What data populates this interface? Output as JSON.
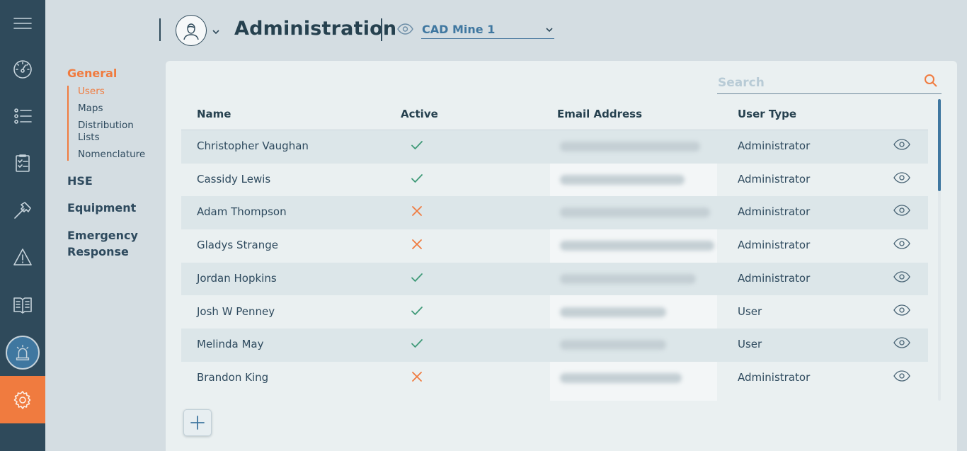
{
  "header": {
    "title": "Administration",
    "site": "CAD Mine 1"
  },
  "subnav": {
    "groups": [
      {
        "label": "General",
        "items": [
          "Users",
          "Maps",
          "Distribution Lists",
          "Nomenclature"
        ]
      },
      {
        "label": "HSE"
      },
      {
        "label": "Equipment"
      },
      {
        "label": "Emergency Response"
      }
    ]
  },
  "search": {
    "placeholder": "Search"
  },
  "table": {
    "columns": [
      "Name",
      "Active",
      "Email Address",
      "User Type"
    ],
    "rows": [
      {
        "name": "Christopher Vaughan",
        "active": true,
        "user_type": "Administrator"
      },
      {
        "name": "Cassidy Lewis",
        "active": true,
        "user_type": "Administrator"
      },
      {
        "name": "Adam Thompson",
        "active": false,
        "user_type": "Administrator"
      },
      {
        "name": "Gladys Strange",
        "active": false,
        "user_type": "Administrator"
      },
      {
        "name": "Jordan Hopkins",
        "active": true,
        "user_type": "Administrator"
      },
      {
        "name": "Josh W Penney",
        "active": true,
        "user_type": "User"
      },
      {
        "name": "Melinda May",
        "active": true,
        "user_type": "User"
      },
      {
        "name": "Brandon King",
        "active": false,
        "user_type": "Administrator"
      }
    ]
  },
  "colors": {
    "accent": "#f07b3f",
    "rail": "#2f4a5b",
    "link": "#3f77a0",
    "active_ok": "#3f9a78"
  },
  "icons": {
    "rail": [
      "hamburger-icon",
      "dashboard-gauge-icon",
      "checklist-icon",
      "clipboard-icon",
      "hammer-icon",
      "warning-icon",
      "book-icon",
      "alarm-beacon-icon",
      "gear-icon"
    ]
  }
}
